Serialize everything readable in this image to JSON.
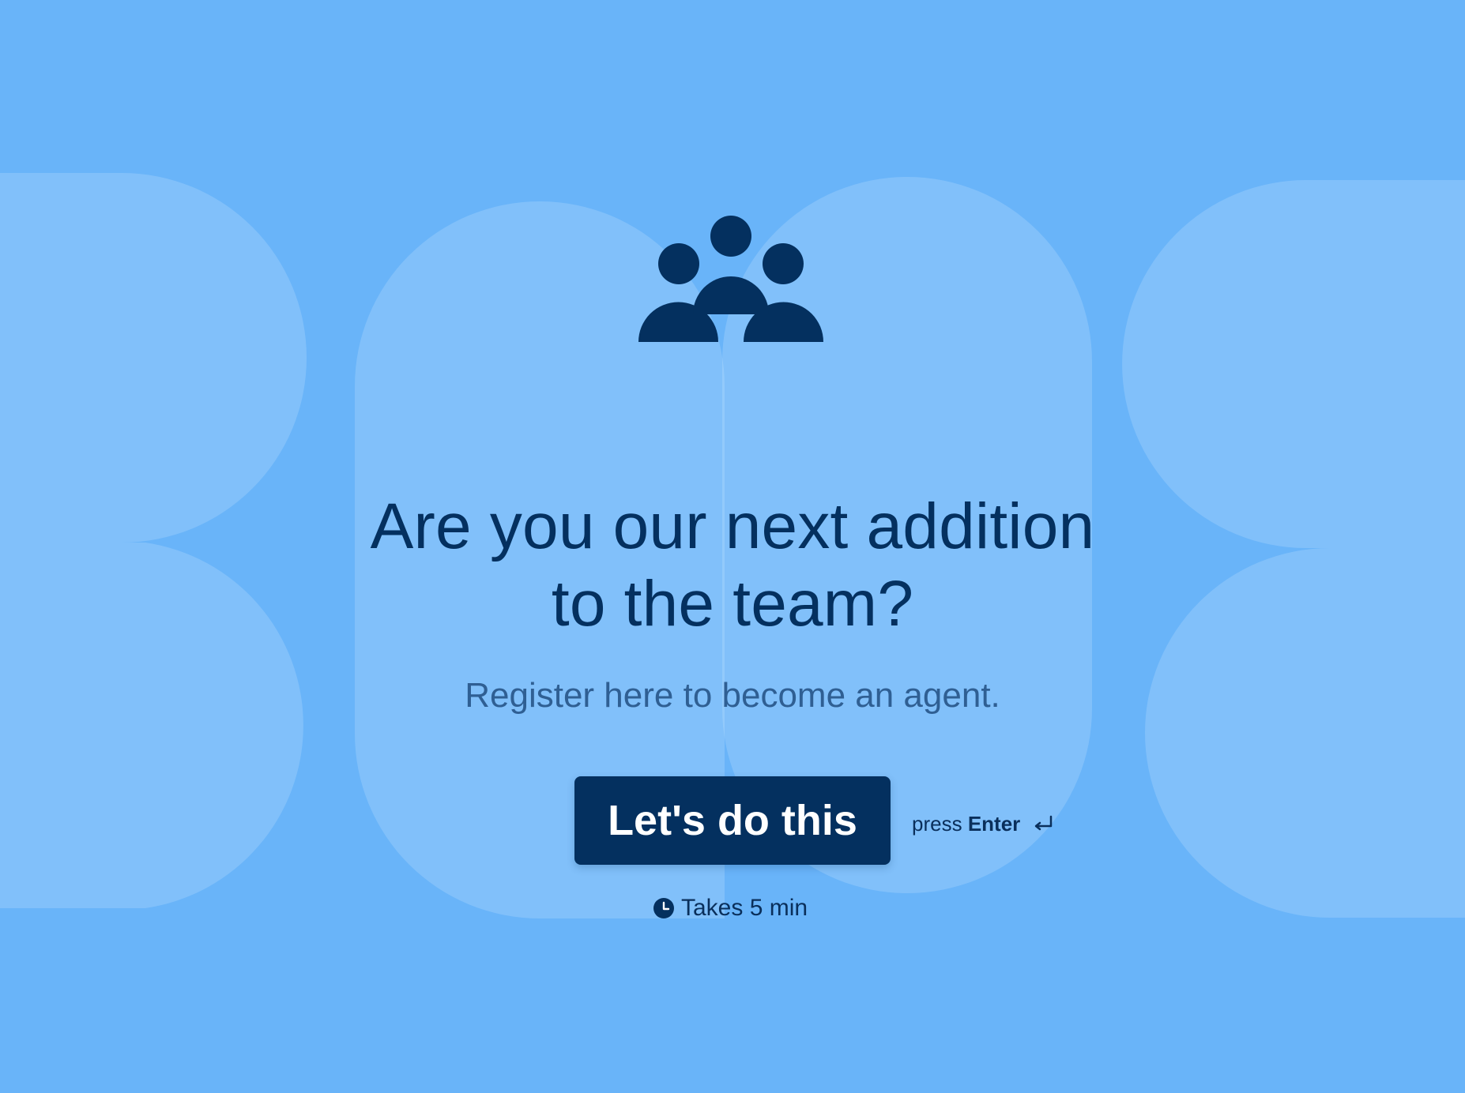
{
  "theme": {
    "background": "#69b4f9",
    "shape_light": "#9bcbfb",
    "text_primary": "#04305f",
    "text_secondary": "#2f5f93",
    "button_background": "#04305f",
    "button_text": "#ffffff"
  },
  "hero": {
    "icon": "team-icon",
    "headline_line1": "Are you our next addition",
    "headline_line2": "to the team?",
    "subheadline": "Register here to become an agent."
  },
  "cta": {
    "button_label": "Let's do this",
    "hint_prefix": "press",
    "hint_key": "Enter",
    "hint_icon": "return-icon"
  },
  "duration": {
    "icon": "clock-icon",
    "label": "Takes 5 min"
  }
}
